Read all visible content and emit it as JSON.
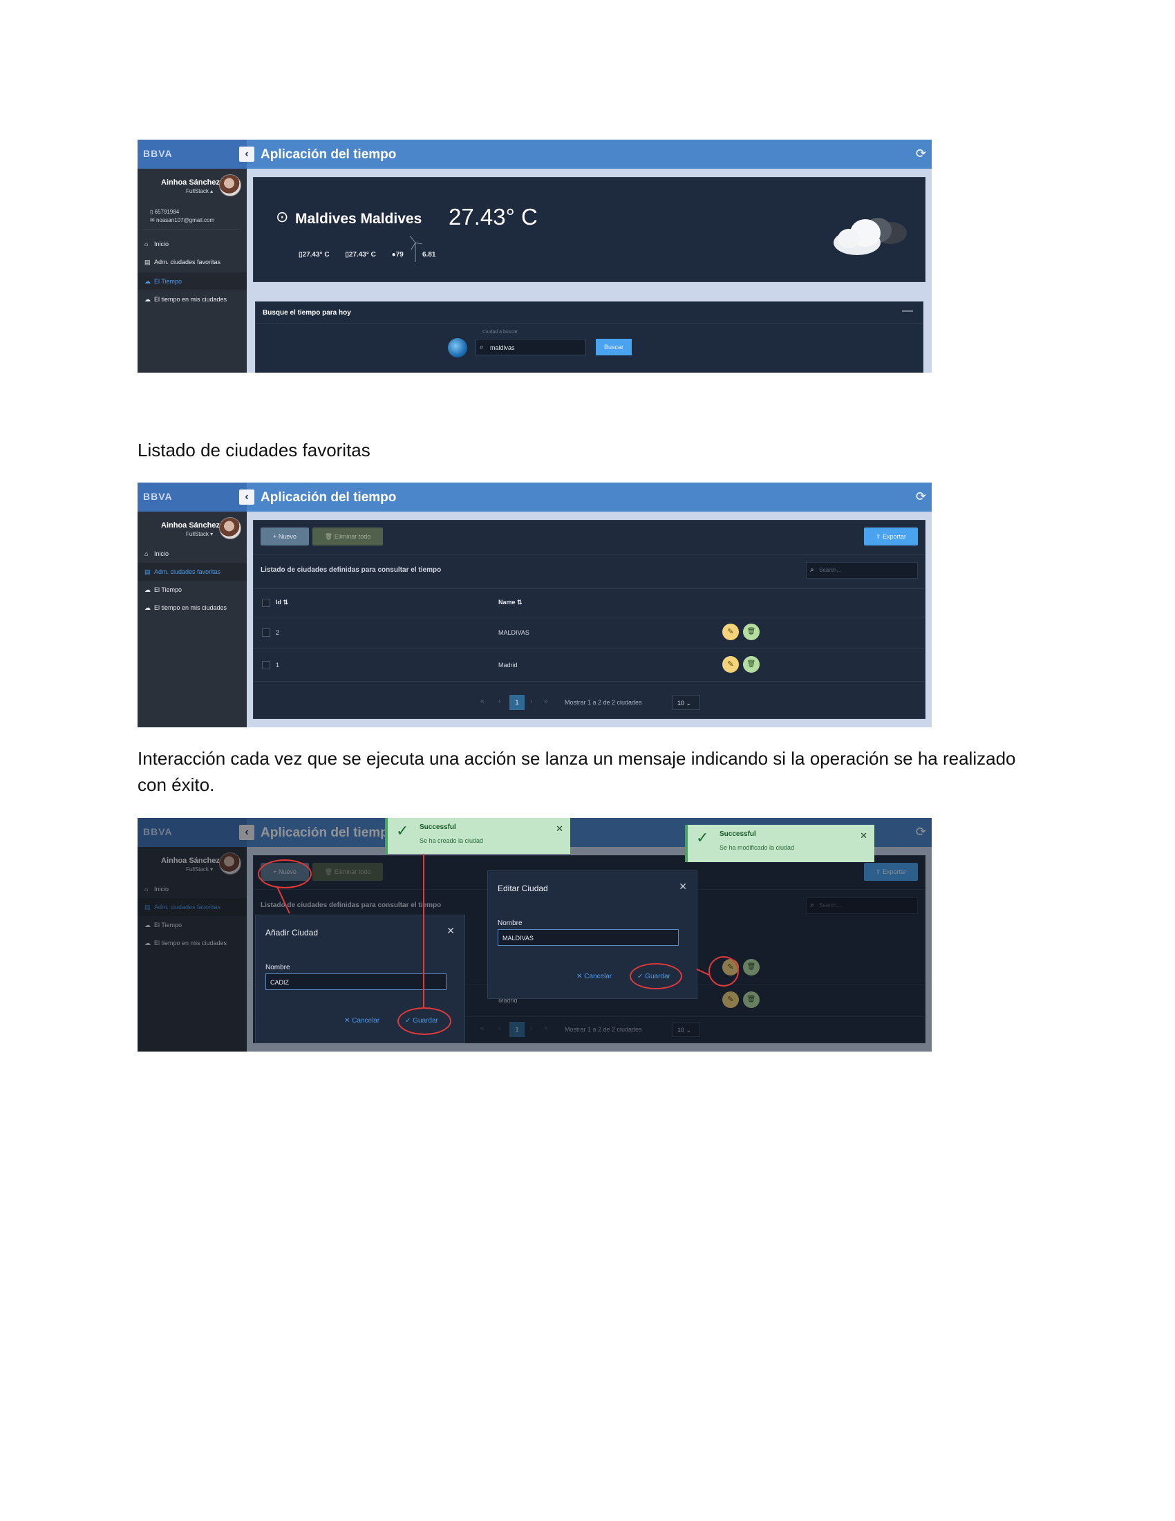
{
  "captions": {
    "favorites_heading": "Listado de ciudades favoritas",
    "interaction_text": "Interacción cada vez que se ejecuta una acción se lanza un mensaje indicando si la operación se ha realizado con éxito."
  },
  "app": {
    "brand": "BBVA",
    "title": "Aplicación del tiempo",
    "user_name": "Ainhoa Sánchez",
    "user_role": "FullStack ▴",
    "phone": "65791984",
    "email": "noasan107@gmail.com"
  },
  "nav": {
    "inicio": "Inicio",
    "favoritas": "Adm. ciudades favoritas",
    "tiempo": "El Tiempo",
    "mis_ciudades": "El tiempo en mis ciudades"
  },
  "weather": {
    "city": "Maldives  Maldives",
    "temperature": "27.43° C",
    "temp_min": "27.43° C",
    "temp_max": "27.43° C",
    "humidity": "79",
    "wind": "6.81",
    "search_title": "Busque el tiempo para hoy",
    "search_label": "Ciudad a buscar",
    "search_value": "maldivas",
    "search_button": "Buscar"
  },
  "list": {
    "new_button": "+ Nuevo",
    "delete_all_button": "Eliminar todo",
    "export_button": "Exportar",
    "title": "Listado de ciudades definidas para consultar el tiempo",
    "search_placeholder": "Search...",
    "col_id": "Id",
    "col_name": "Name",
    "rows": [
      {
        "id": "2",
        "name": "MALDIVAS"
      },
      {
        "id": "1",
        "name": "Madrid"
      }
    ],
    "page": "1",
    "page_info": "Mostrar 1 a 2 de 2 ciudades",
    "page_size": "10"
  },
  "dialogs": {
    "add_title": "Añadir Ciudad",
    "add_label": "Nombre",
    "add_value": "CADIZ",
    "edit_title": "Editar Ciudad",
    "edit_label": "Nombre",
    "edit_value": "MALDIVAS",
    "cancel": "Cancelar",
    "save": "Guardar"
  },
  "toasts": {
    "title": "Successful",
    "created": "Se ha creado la ciudad",
    "modified": "Se ha modificado la ciudad"
  },
  "colors": {
    "topbar": "#4a86c9",
    "sidebar": "#2b313b",
    "accent": "#4aa3ef",
    "annotation": "#e23a3a"
  }
}
